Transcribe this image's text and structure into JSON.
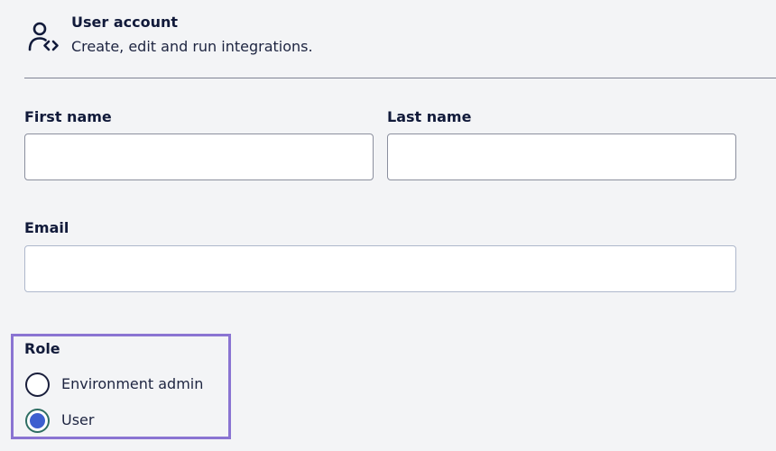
{
  "header": {
    "icon": "user-code-icon",
    "title": "User account",
    "subtitle": "Create, edit and run integrations."
  },
  "form": {
    "first_name": {
      "label": "First name",
      "value": "",
      "placeholder": ""
    },
    "last_name": {
      "label": "Last name",
      "value": "",
      "placeholder": ""
    },
    "email": {
      "label": "Email",
      "value": "",
      "placeholder": ""
    },
    "role": {
      "label": "Role",
      "options": [
        {
          "label": "Environment admin",
          "selected": false
        },
        {
          "label": "User",
          "selected": true
        }
      ]
    }
  },
  "colors": {
    "background": "#f3f4f6",
    "text": "#111a3a",
    "highlight_border": "#8a74d2",
    "radio_selected_fill": "#3d5fcf",
    "radio_selected_ring": "#2f6e63"
  }
}
